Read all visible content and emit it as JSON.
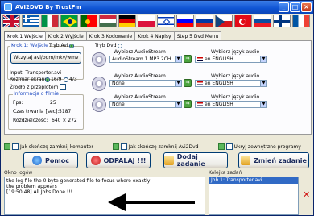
{
  "window": {
    "title": "AVI2DVD By TrustFm"
  },
  "title_buttons": {
    "minimize": "_",
    "maximize": "□",
    "close": "×"
  },
  "flags": [
    "uk",
    "greece",
    "italy",
    "brazil",
    "portugal",
    "hungary",
    "germany",
    "poland",
    "israel",
    "slovenia",
    "russia",
    "czech",
    "turkey",
    "slovakia",
    "finland",
    "france"
  ],
  "tabs": [
    "Krok 1 Wejście",
    "Krok 2 Wyjście",
    "Krok 3 Kodowanie",
    "Krok 4 Napisy",
    "Step 5 Dvd Menu"
  ],
  "step1": {
    "group_label": "Krok 1: Wejście",
    "mode_avi": "Tryb Avi",
    "mode_dvd": "Tryb Dvd",
    "choose_file_button": "Wczytaj avi/ogm/mkv/wmv",
    "input_label": "Input: Transporter.avi",
    "screen_size_label": "Rozmiar ekranu:",
    "ratio_169": "16/9",
    "ratio_43": "4/3",
    "source_enlarge": "Źródło z przeplotem",
    "info_group": "Informacja o filmie",
    "fps_label": "Fps:",
    "fps_value": "25",
    "duration_label": "Czas trwania [sec]:",
    "duration_value": "5187",
    "resolution_label": "Rozdzielczość:",
    "resolution_value": "640 × 272"
  },
  "audio": [
    {
      "label": "Wybierz AudioStream",
      "stream": "AudioStream 1 MP3 2CH",
      "lang_label": "Wybierz język audio",
      "lang": "en ENGLISH"
    },
    {
      "label": "Wybierz AudioStream",
      "stream": "None",
      "lang_label": "Wybierz język audio",
      "lang": "en ENGLISH"
    },
    {
      "label": "Wybierz AudioStream",
      "stream": "None",
      "lang_label": "Wybierz język audio",
      "lang": "en ENGLISH"
    }
  ],
  "checks": {
    "shutdown_pc": "Jak skończę zamknij komputer",
    "close_app": "Jak skończę zamknij Avi2Dvd",
    "hide_external": "Ukryj zewnętrzne programy"
  },
  "buttons": {
    "help": "Pomoc",
    "refresh": "ODPALAJ !!!",
    "add_job": "Dodaj zadanie",
    "change_job": "Zmień zadanie"
  },
  "log": {
    "label": "Okno logów",
    "lines": [
      "the log file the 0 byte generated file to focus where exactly",
      "the problem appears",
      "[19:50:48] All Jobs Done !!!"
    ]
  },
  "queue": {
    "label": "Kolejka zadań",
    "items": [
      "Job 1: Transporter.avi"
    ]
  }
}
